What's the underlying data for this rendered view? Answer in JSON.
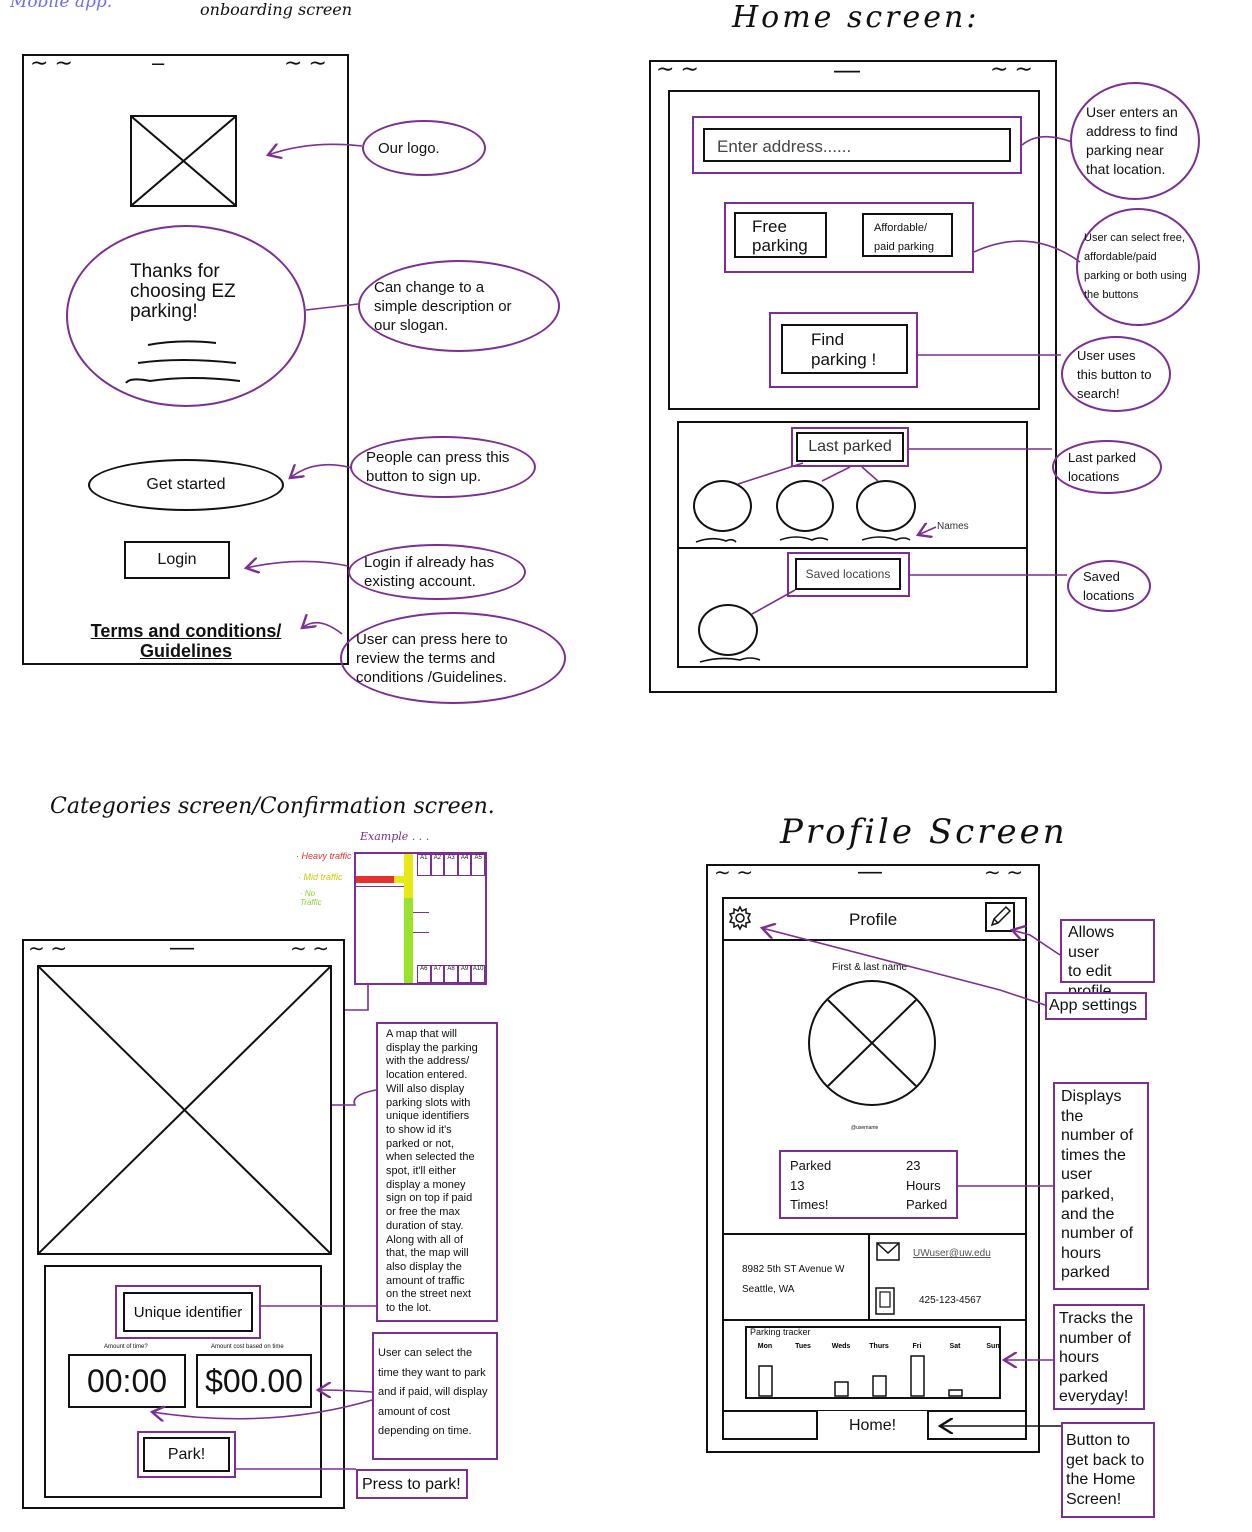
{
  "headings": {
    "corner": "Mobile app.",
    "onboarding": "onboarding screen",
    "home": "Home  screen:",
    "categories": "Categories screen/Confirmation screen.",
    "profile": "Profile  Screen"
  },
  "onboarding": {
    "welcome": "Thanks for\nchoosing EZ\nparking!",
    "get_started": "Get started",
    "login": "Login",
    "terms": "Terms and conditions/\nGuidelines",
    "notes": {
      "logo": "Our logo.",
      "slogan": "Can change to a\nsimple description or\nour slogan.",
      "signup": "People can press this\nbutton to sign up.",
      "login": "Login if already has\nexisting account.",
      "terms": "User can press here to\nreview the terms and\nconditions /Guidelines."
    }
  },
  "home": {
    "address_placeholder": "Enter address......",
    "free": "Free\nparking",
    "affordable": "Affordable/\npaid parking",
    "find": "Find\nparking !",
    "last_parked": "Last parked",
    "saved": "Saved locations",
    "names": "Names",
    "notes": {
      "address": "User enters an\naddress to find\nparking near\nthat location.",
      "filters": "User can select free,\naffordable/paid\nparking or both using\nthe buttons",
      "find": "User uses\nthis button to\nsearch!",
      "last": "Last parked\nlocations",
      "saved": "Saved\nlocations"
    }
  },
  "categories": {
    "example": "Example . . .",
    "legend": {
      "heavy": "· Heavy traffic",
      "mid": "· Mid traffic",
      "none": "· No\n  Traffic"
    },
    "slot_ids_top": [
      "A1",
      "A2",
      "A3",
      "A4",
      "A5"
    ],
    "slot_ids_bottom": [
      "A6",
      "A7",
      "A8",
      "A9",
      "A10"
    ],
    "unique_id": "Unique identifier",
    "time_label": "Amount of time?",
    "cost_label": "Amount cost based on time",
    "time": "00:00",
    "cost": "$00.00",
    "park": "Park!",
    "notes": {
      "map": "A map that will\ndisplay the parking\nwith the address/\nlocation entered.\nWill also display\nparking slots with\nunique identifiers\nto show id it's\nparked or not,\nwhen selected the\nspot, it'll either\ndisplay a money\nsign on top if paid\nor free the max\nduration of stay.\nAlong with all of\nthat, the map will\nalso display the\namount of traffic\non the street next\nto the lot.",
      "time": "User can select the\ntime they want to park\nand if paid, will display\namount of cost\ndepending on time.",
      "park": "Press to park!"
    }
  },
  "profile": {
    "title": "Profile",
    "name": "First & last name",
    "username": "@username",
    "parked": "Parked\n    13\nTimes!",
    "hours": "23\nHours\nParked",
    "address": "8982 5th ST Avenue W\nSeattle, WA",
    "email": "UWuser@uw.edu",
    "phone": "425-123-4567",
    "tracker_title": "Parking tracker",
    "days": [
      "Mon",
      "Tues",
      "Weds",
      "Thurs",
      "Fri",
      "Sat",
      "Sun"
    ],
    "tracker_values": [
      0.75,
      0,
      0.35,
      0.5,
      1,
      0.15,
      0
    ],
    "home": "Home!",
    "notes": {
      "edit": "Allows user\nto edit\nprofile",
      "settings": "App settings",
      "stats": "Displays\nthe\nnumber of\ntimes the\nuser\nparked,\nand the\nnumber of\nhours\nparked",
      "tracker": "Tracks the\nnumber of\nhours\nparked\neveryday!",
      "home": "Button to\nget back to\nthe Home\nScreen!"
    }
  },
  "colors": {
    "accent": "#7b2f93",
    "heavy": "#e8302c",
    "mid": "#f2f20a",
    "none": "#9be22d"
  }
}
